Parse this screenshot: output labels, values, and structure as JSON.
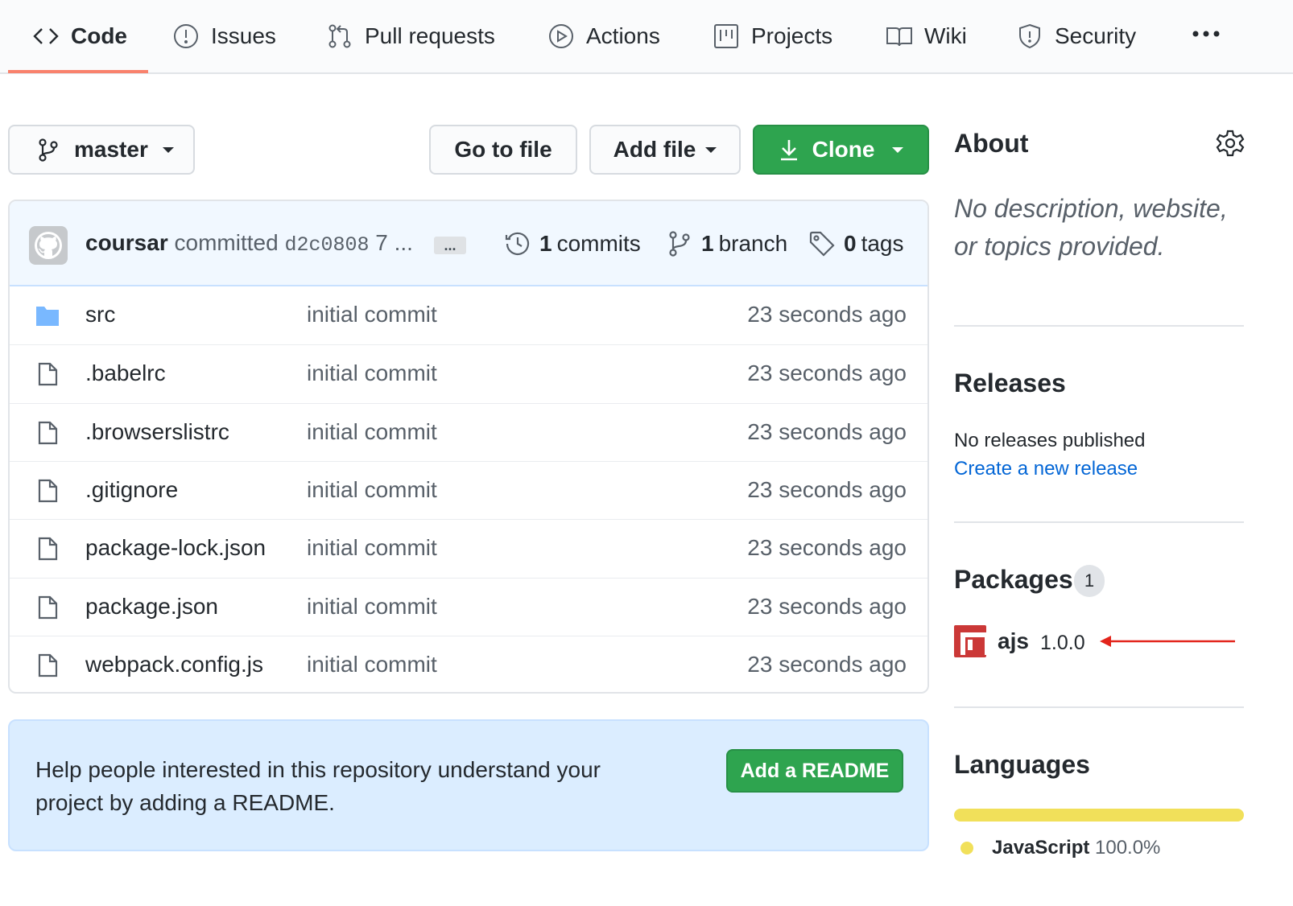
{
  "nav": {
    "tabs": [
      {
        "label": "Code",
        "icon": "code-icon"
      },
      {
        "label": "Issues",
        "icon": "issue-opened-icon"
      },
      {
        "label": "Pull requests",
        "icon": "git-pull-request-icon"
      },
      {
        "label": "Actions",
        "icon": "play-icon"
      },
      {
        "label": "Projects",
        "icon": "project-icon"
      },
      {
        "label": "Wiki",
        "icon": "book-icon"
      },
      {
        "label": "Security",
        "icon": "shield-icon"
      }
    ],
    "active_tab": "Code",
    "active_color": "#f9826c"
  },
  "toolbar": {
    "branch_label": "master",
    "goto_label": "Go to file",
    "addfile_label": "Add file",
    "clone_label": "Clone",
    "clone_color": "#2ea44f"
  },
  "commit": {
    "author": "coursar",
    "action": "committed",
    "sha": "d2c0808",
    "time": "7 ...",
    "ellipsis": "...",
    "commits_count": "1",
    "commits_label": "commits",
    "branch_count": "1",
    "branch_label": "branch",
    "tags_count": "0",
    "tags_label": "tags"
  },
  "files": [
    {
      "name": "src",
      "type": "folder",
      "message": "initial commit",
      "age": "23 seconds ago"
    },
    {
      "name": ".babelrc",
      "type": "file",
      "message": "initial commit",
      "age": "23 seconds ago"
    },
    {
      "name": ".browserslistrc",
      "type": "file",
      "message": "initial commit",
      "age": "23 seconds ago"
    },
    {
      "name": ".gitignore",
      "type": "file",
      "message": "initial commit",
      "age": "23 seconds ago"
    },
    {
      "name": "package-lock.json",
      "type": "file",
      "message": "initial commit",
      "age": "23 seconds ago"
    },
    {
      "name": "package.json",
      "type": "file",
      "message": "initial commit",
      "age": "23 seconds ago"
    },
    {
      "name": "webpack.config.js",
      "type": "file",
      "message": "initial commit",
      "age": "23 seconds ago"
    }
  ],
  "readme": {
    "text": "Help people interested in this repository understand your project by adding a README.",
    "button": "Add a README"
  },
  "sidebar": {
    "about_title": "About",
    "about_desc": "No description, website, or topics provided.",
    "releases_title": "Releases",
    "releases_none": "No releases published",
    "releases_link": "Create a new release",
    "packages_title": "Packages",
    "packages_count": "1",
    "package": {
      "name": "ajs",
      "version": "1.0.0",
      "icon": "npm-icon",
      "color": "#cb3837"
    },
    "languages_title": "Languages",
    "language": {
      "name": "JavaScript",
      "percent": "100.0%",
      "share": 1.0,
      "color": "#f1e05a"
    }
  },
  "annotation": {
    "arrow_color": "#e3241b"
  }
}
